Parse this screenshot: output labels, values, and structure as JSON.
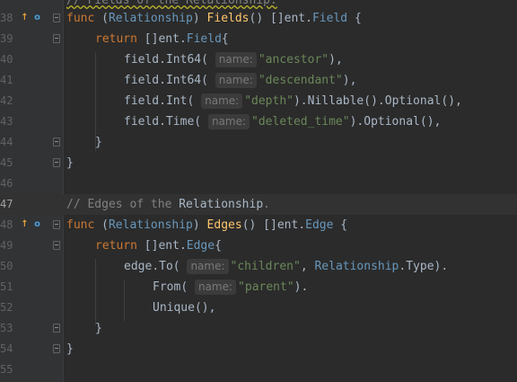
{
  "gutter": {
    "line_numbers": [
      "38",
      "39",
      "40",
      "41",
      "42",
      "43",
      "44",
      "45",
      "46",
      "47",
      "48",
      "49",
      "50",
      "51",
      "52",
      "53",
      "54",
      "55"
    ],
    "implements_icon": "implemented-method-icon",
    "overrides_icon": "overridden-method-icon"
  },
  "code": {
    "top_comment": "// Fields of the Relationship.",
    "line_38": {
      "func": "func",
      "recv_open": "(",
      "recv_type": "Relationship",
      "recv_close": ")",
      "name": "Fields",
      "parens": "()",
      "ret_prefix": "[]",
      "ret_pkg": "ent",
      "ret_type": "Field",
      "brace": "{"
    },
    "line_39": {
      "kw": "return",
      "prefix": "[]",
      "pkg": "ent",
      "type": "Field",
      "brace": "{"
    },
    "line_40": {
      "recv": "field",
      "method": "Int64",
      "hint": "name:",
      "arg": "\"ancestor\"",
      "tail": "),"
    },
    "line_41": {
      "recv": "field",
      "method": "Int64",
      "hint": "name:",
      "arg": "\"descendant\"",
      "tail": "),"
    },
    "line_42": {
      "recv": "field",
      "method": "Int",
      "hint": "name:",
      "arg": "\"depth\"",
      "chain1": "Nillable",
      "chain2": "Optional",
      "tail": ")."
    },
    "line_43": {
      "recv": "field",
      "method": "Time",
      "hint": "name:",
      "arg": "\"deleted_time\"",
      "chain1": "Optional",
      "tail": ")."
    },
    "line_44": "}",
    "line_45": "}",
    "line_47": {
      "comment_prefix": "// Edges of the ",
      "comment_type": "Relationship",
      "comment_suffix": "."
    },
    "line_48": {
      "func": "func",
      "recv_open": "(",
      "recv_type": "Relationship",
      "recv_close": ")",
      "name": "Edges",
      "parens": "()",
      "ret_prefix": "[]",
      "ret_pkg": "ent",
      "ret_type": "Edge",
      "brace": "{"
    },
    "line_49": {
      "kw": "return",
      "prefix": "[]",
      "pkg": "ent",
      "type": "Edge",
      "brace": "{"
    },
    "line_50": {
      "recv": "edge",
      "method": "To",
      "hint": "name:",
      "arg": "\"children\"",
      "type_pkg": "Relationship",
      "type_field": "Type",
      "tail": ")."
    },
    "line_51": {
      "method": "From",
      "hint": "name:",
      "arg": "\"parent\"",
      "tail": ")."
    },
    "line_52": {
      "method": "Unique",
      "tail": "(),"
    },
    "line_53": "}",
    "line_54": "}"
  }
}
